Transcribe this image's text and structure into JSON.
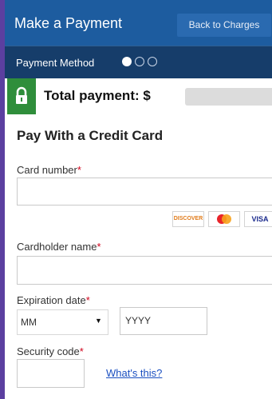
{
  "header": {
    "title": "Make a Payment",
    "back_label": "Back to Charges"
  },
  "method_bar": {
    "label": "Payment Method",
    "steps_total": 3,
    "active_step": 1
  },
  "total": {
    "label": "Total payment: $",
    "value_masked": true
  },
  "section": {
    "title": "Pay With a Credit Card"
  },
  "form": {
    "card_number_label": "Card number",
    "cardholder_label": "Cardholder name",
    "expiration_label": "Expiration date",
    "month_value": "MM",
    "year_placeholder": "YYYY",
    "security_label": "Security code",
    "whats_this": "What's this?",
    "required_marker": "*"
  },
  "card_brands": [
    {
      "name": "DISCOVER",
      "icon": "discover-icon"
    },
    {
      "name": "MasterCard",
      "icon": "mastercard-icon"
    },
    {
      "name": "VISA",
      "icon": "visa-icon"
    }
  ],
  "colors": {
    "header_bg": "#1d5c9f",
    "method_bg": "#163d6a",
    "lock_bg": "#2f8e3b",
    "required": "#d0021b",
    "link": "#1a4fc0"
  }
}
